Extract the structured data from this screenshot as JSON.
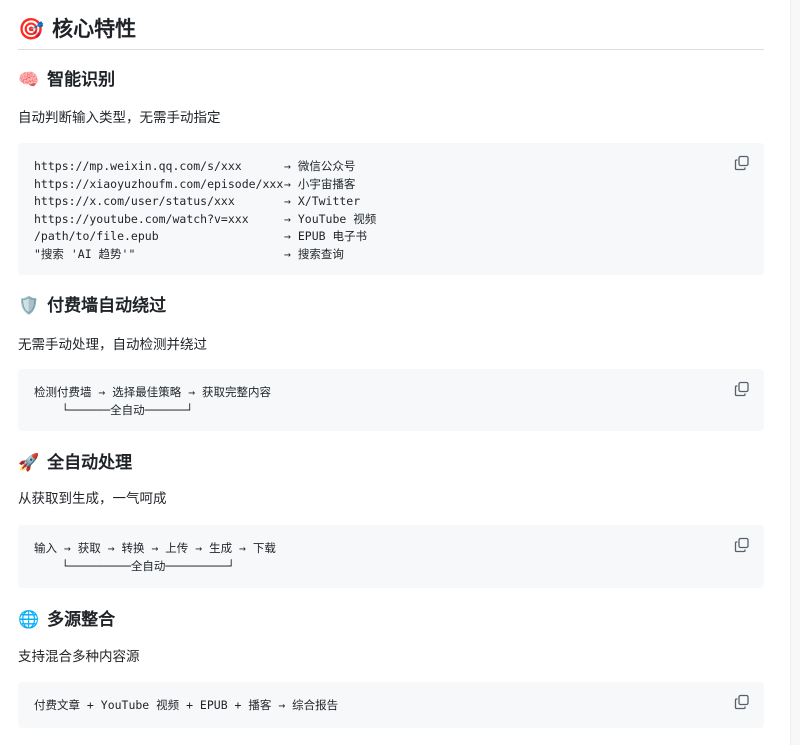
{
  "main_heading": {
    "emoji": "🎯",
    "text": "核心特性"
  },
  "sections": [
    {
      "emoji": "🧠",
      "title": "智能识别",
      "description": "自动判断输入类型，无需手动指定",
      "code_lines": [
        {
          "left": "https://mp.weixin.qq.com/s/xxx",
          "right": "→ 微信公众号"
        },
        {
          "left": "https://xiaoyuzhoufm.com/episode/xxx",
          "right": "→ 小宇宙播客"
        },
        {
          "left": "https://x.com/user/status/xxx",
          "right": "→ X/Twitter"
        },
        {
          "left": "https://youtube.com/watch?v=xxx",
          "right": "→ YouTube 视频"
        },
        {
          "left": "/path/to/file.epub",
          "right": "→ EPUB 电子书"
        },
        {
          "left": "\"搜索 'AI 趋势'\"",
          "right": "→ 搜索查询"
        }
      ]
    },
    {
      "emoji": "🛡️",
      "title": "付费墙自动绕过",
      "description": "无需手动处理，自动检测并绕过",
      "code_lines": [
        {
          "left": "检测付费墙 → 选择最佳策略 → 获取完整内容",
          "right": ""
        },
        {
          "left": "    └──────全自动──────┘",
          "right": ""
        }
      ]
    },
    {
      "emoji": "🚀",
      "title": "全自动处理",
      "description": "从获取到生成，一气呵成",
      "code_lines": [
        {
          "left": "输入 → 获取 → 转换 → 上传 → 生成 → 下载",
          "right": ""
        },
        {
          "left": "    └─────────全自动─────────┘",
          "right": ""
        }
      ]
    },
    {
      "emoji": "🌐",
      "title": "多源整合",
      "description": "支持混合多种内容源",
      "code_lines": [
        {
          "left": "付费文章 + YouTube 视频 + EPUB + 播客 → 综合报告",
          "right": ""
        }
      ]
    }
  ],
  "colors": {
    "text": "#1f2328",
    "code_bg": "#f6f8fa",
    "divider": "#d8dee4",
    "icon": "#57606a"
  },
  "icons": {
    "copy": "copy-icon"
  }
}
